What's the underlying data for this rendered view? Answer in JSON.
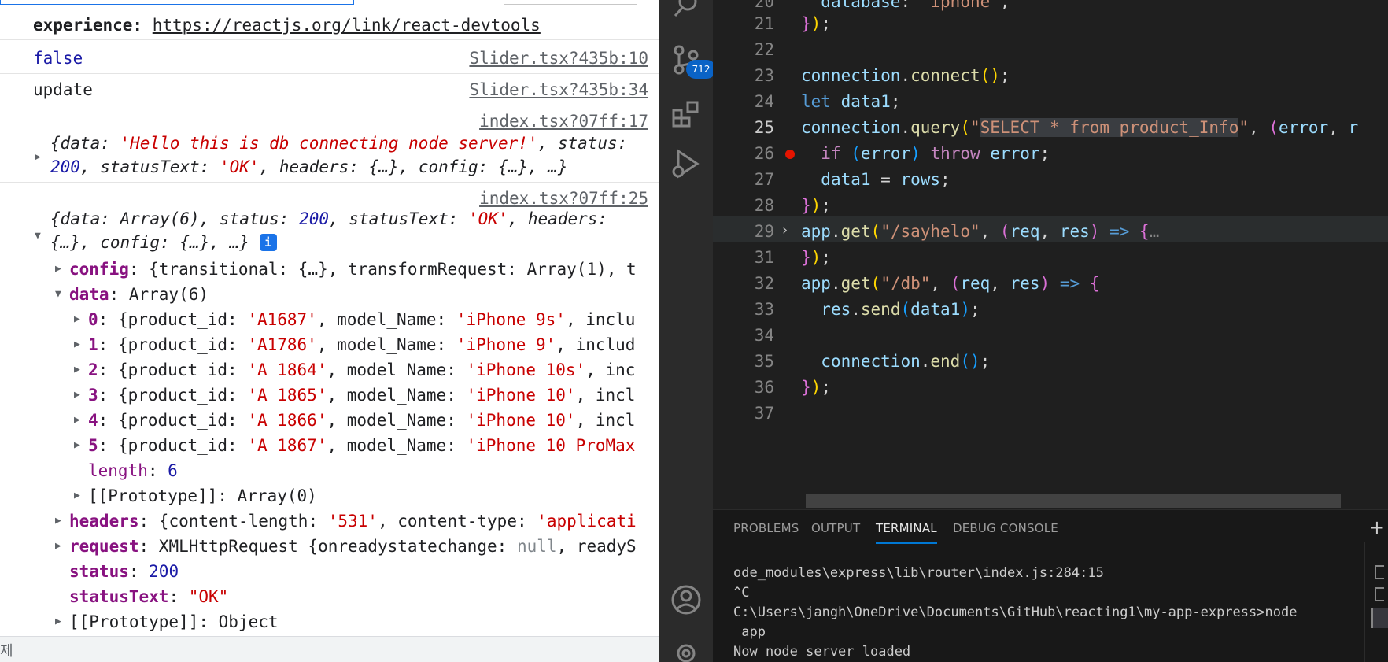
{
  "console": {
    "partial_line": {
      "label": "experience:",
      "link": "https://reactjs.org/link/react-devtools"
    },
    "logs": [
      {
        "text": "false",
        "source": "Slider.tsx?435b:10"
      },
      {
        "text": "update",
        "source": "Slider.tsx?435b:34"
      }
    ],
    "response1": {
      "source": "index.tsx?07ff:17",
      "line1_a": "{data: ",
      "line1_str": "'Hello this is db connecting node server!'",
      "line1_b": ", status:",
      "line2_num": "200",
      "line2_a": ", statusText: ",
      "line2_str": "'OK'",
      "line2_b": ", headers: {…}, config: {…}, …}"
    },
    "response2": {
      "source": "index.tsx?07ff:25",
      "line1_a": "{data: Array(6), status: ",
      "line1_num": "200",
      "line1_b": ", statusText: ",
      "line1_str": "'OK'",
      "line1_c": ", headers:",
      "line2": "{…}, config: {…}, …}",
      "info_icon": "i",
      "config_key": "config",
      "config_val": ": {transitional: {…}, transformRequest: Array(1), t",
      "data_key": "data",
      "data_val": ": Array(6)",
      "items": [
        {
          "idx": "0",
          "id": "'A1687'",
          "model": "'iPhone 9s'",
          "tail": ", inclu"
        },
        {
          "idx": "1",
          "id": "'A1786'",
          "model": "'iPhone 9'",
          "tail": ", includ"
        },
        {
          "idx": "2",
          "id": "'A 1864'",
          "model": "'iPhone 10s'",
          "tail": ", inc"
        },
        {
          "idx": "3",
          "id": "'A 1865'",
          "model": "'iPhone 10'",
          "tail": ", incl"
        },
        {
          "idx": "4",
          "id": "'A 1866'",
          "model": "'iPhone 10'",
          "tail": ", incl"
        },
        {
          "idx": "5",
          "id": "'A 1867'",
          "model": "'iPhone 10 ProMax",
          "tail": ""
        }
      ],
      "product_id_label": "{product_id: ",
      "model_label": ", model_Name: ",
      "length_key": "length",
      "length_val": "6",
      "proto_inner": "[[Prototype]]: Array(0)",
      "headers_key": "headers",
      "headers_a": ": {content-length: ",
      "headers_str1": "'531'",
      "headers_b": ", content-type: ",
      "headers_str2": "'applicati",
      "request_key": "request",
      "request_a": ": XMLHttpRequest {onreadystatechange: ",
      "request_null": "null",
      "request_b": ", readyS",
      "status_key": "status",
      "status_val": "200",
      "statustext_key": "statusText",
      "statustext_val": "\"OK\"",
      "proto_outer": "[[Prototype]]: Object"
    },
    "bottom_char": "제"
  },
  "editor": {
    "line_numbers": [
      "21",
      "22",
      "23",
      "24",
      "25",
      "26",
      "27",
      "28",
      "29",
      "31",
      "32",
      "33",
      "34",
      "35",
      "36",
      "37"
    ],
    "current_line": "25"
  },
  "panel": {
    "tabs": [
      "PROBLEMS",
      "OUTPUT",
      "TERMINAL",
      "DEBUG CONSOLE"
    ],
    "active_tab": "TERMINAL",
    "terminal_lines": [
      "ode_modules\\express\\lib\\router\\index.js:284:15",
      "^C",
      "C:\\Users\\jangh\\OneDrive\\Documents\\GitHub\\reacting1\\my-app-express>node",
      " app",
      "Now node server loaded"
    ]
  },
  "activity": {
    "scm_badge": "712"
  },
  "colors": {
    "accent": "#0078d4",
    "badge": "#0a63c6",
    "breakpoint": "#e51400"
  }
}
